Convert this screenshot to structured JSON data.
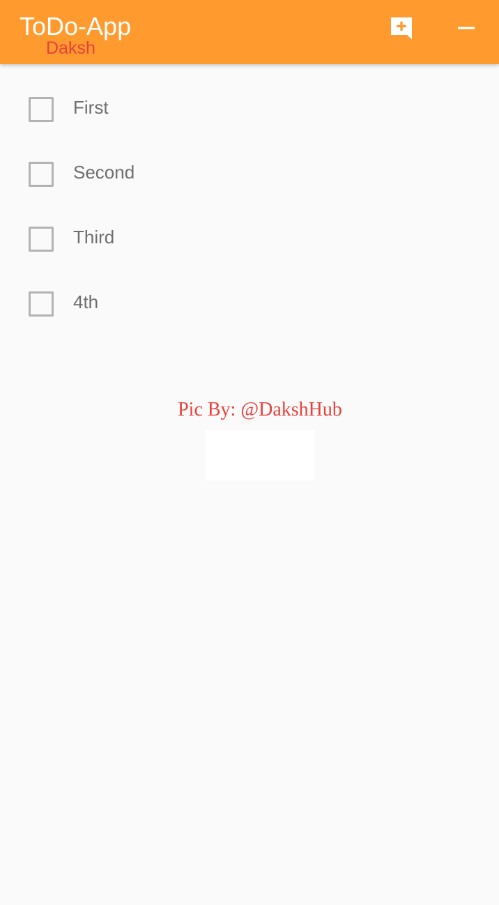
{
  "app_bar": {
    "title": "ToDo-App",
    "subtitle": "Daksh",
    "color": "#ff9a2e",
    "subtitle_color": "#e8413b",
    "actions": [
      {
        "icon": "add-comment-icon"
      },
      {
        "icon": "remove-icon"
      }
    ]
  },
  "todos": [
    {
      "label": "First",
      "checked": false
    },
    {
      "label": "Second",
      "checked": false
    },
    {
      "label": "Third",
      "checked": false
    },
    {
      "label": "4th",
      "checked": false
    }
  ],
  "credit": {
    "text": "Pic By: @DakshHub",
    "color": "#e8413b"
  }
}
